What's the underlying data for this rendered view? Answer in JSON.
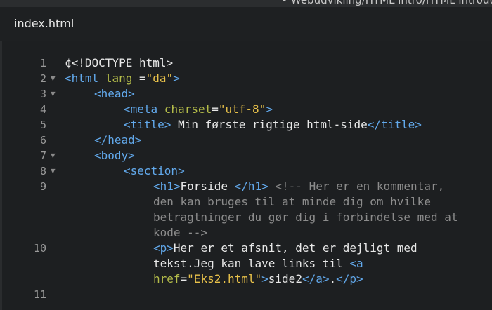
{
  "window": {
    "path_title": "• Webudvikling/HTML intro/HTML introdu"
  },
  "tab": {
    "filename": "index.html"
  },
  "colors": {
    "tag": "#62a9ec",
    "attr": "#b5bd4a",
    "string": "#e8c14a",
    "comment": "#8c8c8c",
    "text": "#e8e8e8"
  },
  "gutter": {
    "numbers": [
      "1",
      "2",
      "3",
      "4",
      "5",
      "6",
      "7",
      "8",
      "9",
      "10",
      "11"
    ],
    "fold_icon": "fold-triangle-down-icon"
  },
  "code": {
    "l1": {
      "text": "¢<!DOCTYPE html>"
    },
    "l2": {
      "open": "<html",
      "attr": "lang",
      "eq": " =",
      "val": "\"da\"",
      "close": ">"
    },
    "l3": {
      "tag": "<head>"
    },
    "l4": {
      "open": "<meta",
      "attr": "charset",
      "eq": "=",
      "val": "\"utf-8\"",
      "close": ">"
    },
    "l5": {
      "open": "<title>",
      "text": " Min første rigtige html-side",
      "close": "</title>"
    },
    "l6": {
      "tag": "</head>"
    },
    "l7": {
      "tag": "<body>"
    },
    "l8": {
      "tag": "<section>"
    },
    "l9": {
      "open": "<h1>",
      "text": "Forside ",
      "close": "</h1>",
      "comment_1": " <!-- Her er en kommentar,",
      "comment_2": "den kan bruges til at minde dig om hvilke",
      "comment_3": "betragtninger du gør dig i forbindelse med at",
      "comment_4": "kode -->"
    },
    "l10": {
      "open_p": "<p>",
      "text_1": "Her er et afsnit, det er dejligt med",
      "text_2": "tekst.Jeg kan lave links til ",
      "open_a": "<a",
      "attr": "href",
      "eq": "=",
      "val": "\"Eks2.html\"",
      "gt": ">",
      "link_text": "side2",
      "close_a": "</a>",
      "dot": ".",
      "close_p": "</p>"
    }
  }
}
